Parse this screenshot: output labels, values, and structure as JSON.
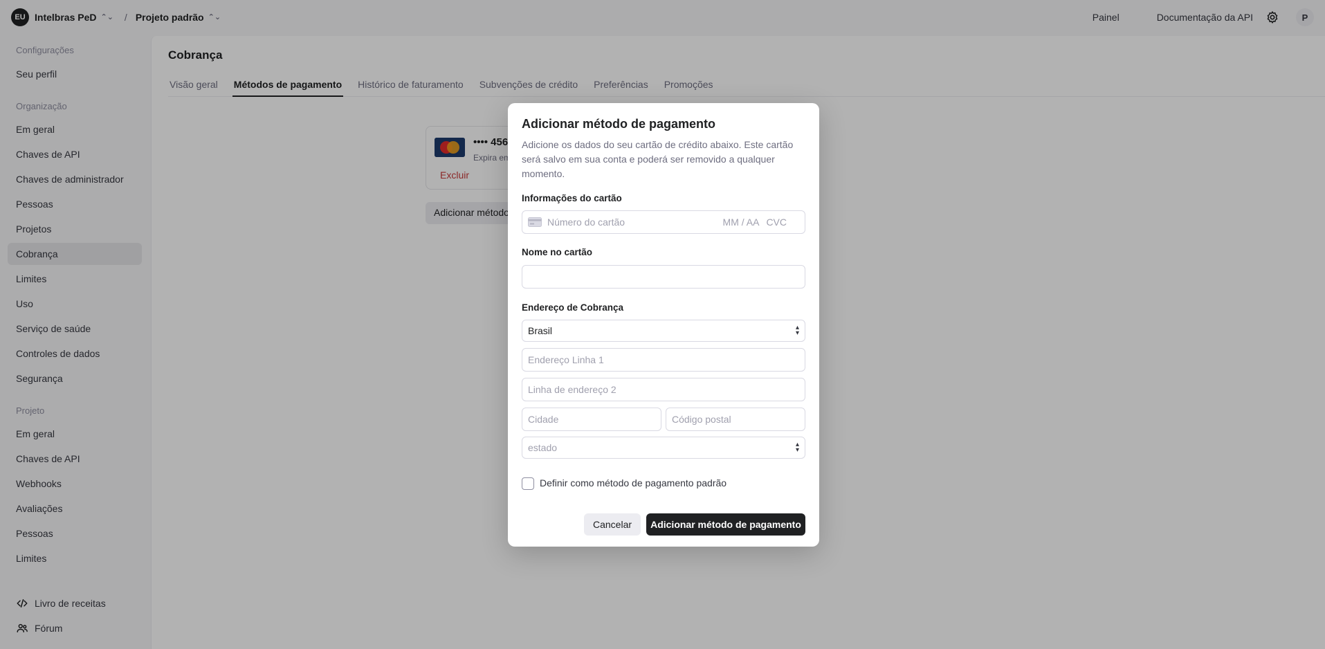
{
  "topbar": {
    "org_avatar": "EU",
    "org_name": "Intelbras PeD",
    "separator": "/",
    "project_name": "Projeto padrão",
    "links": [
      "Painel",
      "Documentação da API"
    ],
    "user_initial": "P"
  },
  "sidebar": {
    "sections": {
      "settings": "Configurações",
      "organization": "Organização",
      "project": "Projeto"
    },
    "profile": "Seu perfil",
    "org_items": [
      "Em geral",
      "Chaves de API",
      "Chaves de administrador",
      "Pessoas",
      "Projetos",
      "Cobrança",
      "Limites",
      "Uso",
      "Serviço de saúde",
      "Controles de dados",
      "Segurança"
    ],
    "project_items": [
      "Em geral",
      "Chaves de API",
      "Webhooks",
      "Avaliações",
      "Pessoas",
      "Limites"
    ],
    "footer": [
      "Livro de receitas",
      "Fórum"
    ],
    "active": "Cobrança"
  },
  "main": {
    "title": "Cobrança",
    "tabs": [
      "Visão geral",
      "Métodos de pagamento",
      "Histórico de faturamento",
      "Subvenções de crédito",
      "Preferências",
      "Promoções"
    ],
    "active_tab": "Métodos de pagamento",
    "card": {
      "number": "•••• 456",
      "expiry": "Expira em",
      "delete": "Excluir"
    },
    "add_button": "Adicionar método"
  },
  "modal": {
    "title": "Adicionar método de pagamento",
    "description": "Adicione os dados do seu cartão de crédito abaixo. Este cartão será salvo em sua conta e poderá ser removido a qualquer momento.",
    "card_info_label": "Informações do cartão",
    "card_number_placeholder": "Número do cartão",
    "expiry_placeholder": "MM / AA",
    "cvc_placeholder": "CVC",
    "name_label": "Nome no cartão",
    "name_value": "",
    "billing_label": "Endereço de Cobrança",
    "country": "Brasil",
    "address1_placeholder": "Endereço Linha 1",
    "address2_placeholder": "Linha de endereço 2",
    "city_placeholder": "Cidade",
    "postal_placeholder": "Código postal",
    "state": "estado",
    "default_checkbox_label": "Definir como método de pagamento padrão",
    "default_checked": false,
    "cancel": "Cancelar",
    "submit": "Adicionar método de pagamento"
  },
  "colors": {
    "accent": "#202123",
    "danger": "#c83a3a",
    "sidebar_active": "#e5e5e8"
  }
}
